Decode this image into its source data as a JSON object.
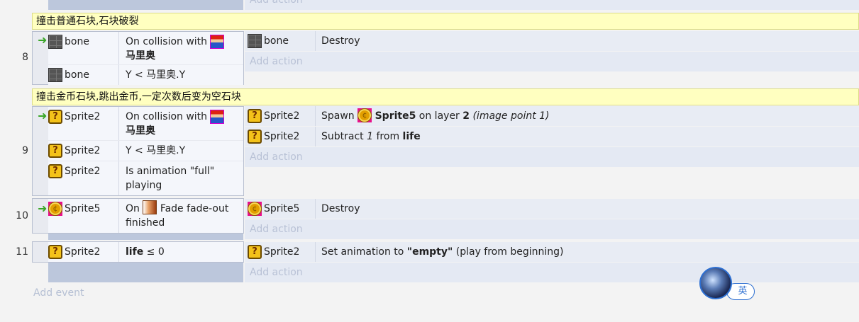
{
  "top": {
    "add_action": "Add action"
  },
  "events": [
    {
      "number": "8",
      "comment": "撞击普通石块,石块破裂",
      "conditions": [
        {
          "object": "bone",
          "text": "On collision with",
          "target": "马里奥",
          "trigger": true
        },
        {
          "object": "bone",
          "text": "Y < 马里奥.Y"
        }
      ],
      "actions": [
        {
          "object": "bone",
          "text": "Destroy"
        }
      ],
      "add_action": "Add action"
    },
    {
      "number": "9",
      "comment": "撞击金币石块,跳出金币,一定次数后变为空石块",
      "conditions": [
        {
          "object": "Sprite2",
          "text": "On collision with",
          "target": "马里奥",
          "trigger": true
        },
        {
          "object": "Sprite2",
          "text": "Y < 马里奥.Y"
        },
        {
          "object": "Sprite2",
          "text": "Is animation \"full\" playing"
        }
      ],
      "actions": [
        {
          "object": "Sprite2",
          "verb": "Spawn",
          "spawn_obj": "Sprite5",
          "on_layer": "on layer",
          "layer": "2",
          "image_point": "(image point 1)"
        },
        {
          "object": "Sprite2",
          "verb": "Subtract",
          "amount": "1",
          "from": "from",
          "var": "life"
        }
      ],
      "add_action": "Add action"
    },
    {
      "number": "10",
      "conditions": [
        {
          "object": "Sprite5",
          "on": "On",
          "text": "Fade fade-out finished",
          "trigger": true
        }
      ],
      "actions": [
        {
          "object": "Sprite5",
          "text": "Destroy"
        }
      ],
      "add_action": "Add action"
    },
    {
      "number": "11",
      "conditions": [
        {
          "object": "Sprite2",
          "var": "life",
          "op": "≤ 0"
        }
      ],
      "actions": [
        {
          "object": "Sprite2",
          "prefix": "Set animation to",
          "anim": "\"empty\"",
          "suffix": "(play from beginning)"
        }
      ],
      "add_action": "Add action"
    }
  ],
  "add_event": "Add event",
  "ime_label": "英",
  "colors": {
    "comment_bg": "#ffffc0",
    "action_bg": "#e8ecf4",
    "trigger_arrow": "#3aa629",
    "accent": "#2d6fd1"
  }
}
